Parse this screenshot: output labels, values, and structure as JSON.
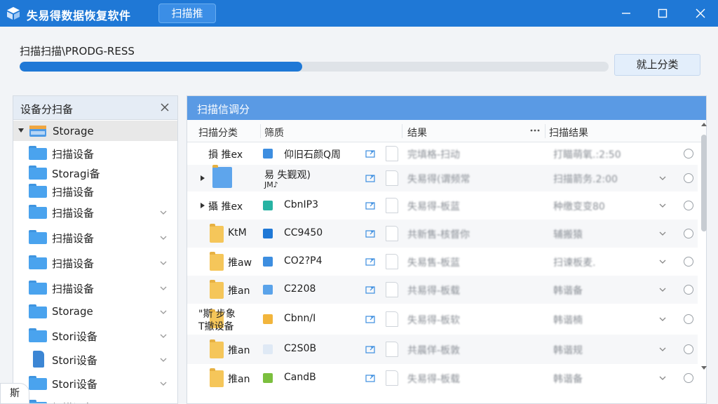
{
  "window": {
    "title": "失易得数据恢复软件",
    "tab_label": "扫描推",
    "minimize_icon": "minimize-icon",
    "maximize_icon": "maximize-icon",
    "close_icon": "close-icon",
    "accent": "#1f78d6"
  },
  "progress": {
    "label": "扫描扫描\\PRODG-RESS",
    "percent": 48,
    "button_label": "就上分类"
  },
  "left_panel": {
    "title": "设备分扫备",
    "root_label": "Storage",
    "items": [
      {
        "label": "扫描设备",
        "chevron": false,
        "icon": "folder-icon"
      },
      {
        "label": "Storagi备",
        "chevron": false,
        "icon": "folder-icon"
      },
      {
        "label": "扫描设备",
        "chevron": false,
        "icon": "folder-icon"
      },
      {
        "label": "扫描设备",
        "chevron": true,
        "icon": "folder-icon"
      },
      {
        "label": "扫描设备",
        "chevron": true,
        "icon": "folder-icon"
      },
      {
        "label": "扫描设备",
        "chevron": true,
        "icon": "folder-icon"
      },
      {
        "label": "扫描设备",
        "chevron": true,
        "icon": "folder-icon"
      },
      {
        "label": "Storage",
        "chevron": true,
        "icon": "folder-icon"
      },
      {
        "label": "Stori设备",
        "chevron": true,
        "icon": "folder-icon"
      },
      {
        "label": "Stori设备",
        "chevron": true,
        "icon": "document-icon"
      },
      {
        "label": "Stori设备",
        "chevron": true,
        "icon": "folder-icon"
      },
      {
        "label": "扫描设备",
        "chevron": false,
        "icon": "folder-icon"
      }
    ]
  },
  "right_panel": {
    "title": "扫描信调分",
    "columns": [
      "扫描分类",
      "筛质",
      "结果",
      "扫描结果"
    ],
    "more_icon": "more-icon",
    "rows": [
      {
        "c1": "損 推ex",
        "c2": "仰旧石颜Q周",
        "c3": "完填格-扫动",
        "c4": "打瞄萌氧.:2:50",
        "chevron": false,
        "alt": false
      },
      {
        "c1": "",
        "c2": "易 失觐观)",
        "c2b": "JM♪",
        "c3": "失易得(谓频常",
        "c4": "扫描箭务.2:00",
        "chevron": true,
        "alt": true
      },
      {
        "c1": "攝 推ex",
        "c2": "CbnIP3",
        "c3": "失易得-板蓝",
        "c4": "种缴变变80",
        "chevron": true,
        "alt": false
      },
      {
        "c1": "KtM",
        "c2": "CC9450",
        "c3": "共新售-核督你",
        "c4": "辅搬猿",
        "chevron": true,
        "alt": true
      },
      {
        "c1": "推aw",
        "c2": "CO2?P4",
        "c3": "失易售-板蓝",
        "c4": "扫谏板麦.",
        "chevron": true,
        "alt": false
      },
      {
        "c1": "推an",
        "c2": "C2208",
        "c3": "共易得-板载",
        "c4": "韩谐备",
        "chevron": true,
        "alt": true
      },
      {
        "c1": "\"斯 步象",
        "c1b": "T撤设备",
        "c2": "Cbnn/I",
        "c3": "失易得-板软",
        "c4": "韩谐楠",
        "chevron": true,
        "alt": false
      },
      {
        "c1": "推an",
        "c2": "C2S0B",
        "c3": "共晨佯-板敦",
        "c4": "韩谐规",
        "chevron": true,
        "alt": true
      },
      {
        "c1": "推an",
        "c2": "CandB",
        "c3": "失易得-板载",
        "c4": "韩谐备",
        "chevron": true,
        "alt": false
      }
    ]
  },
  "corner_badge": "斯"
}
